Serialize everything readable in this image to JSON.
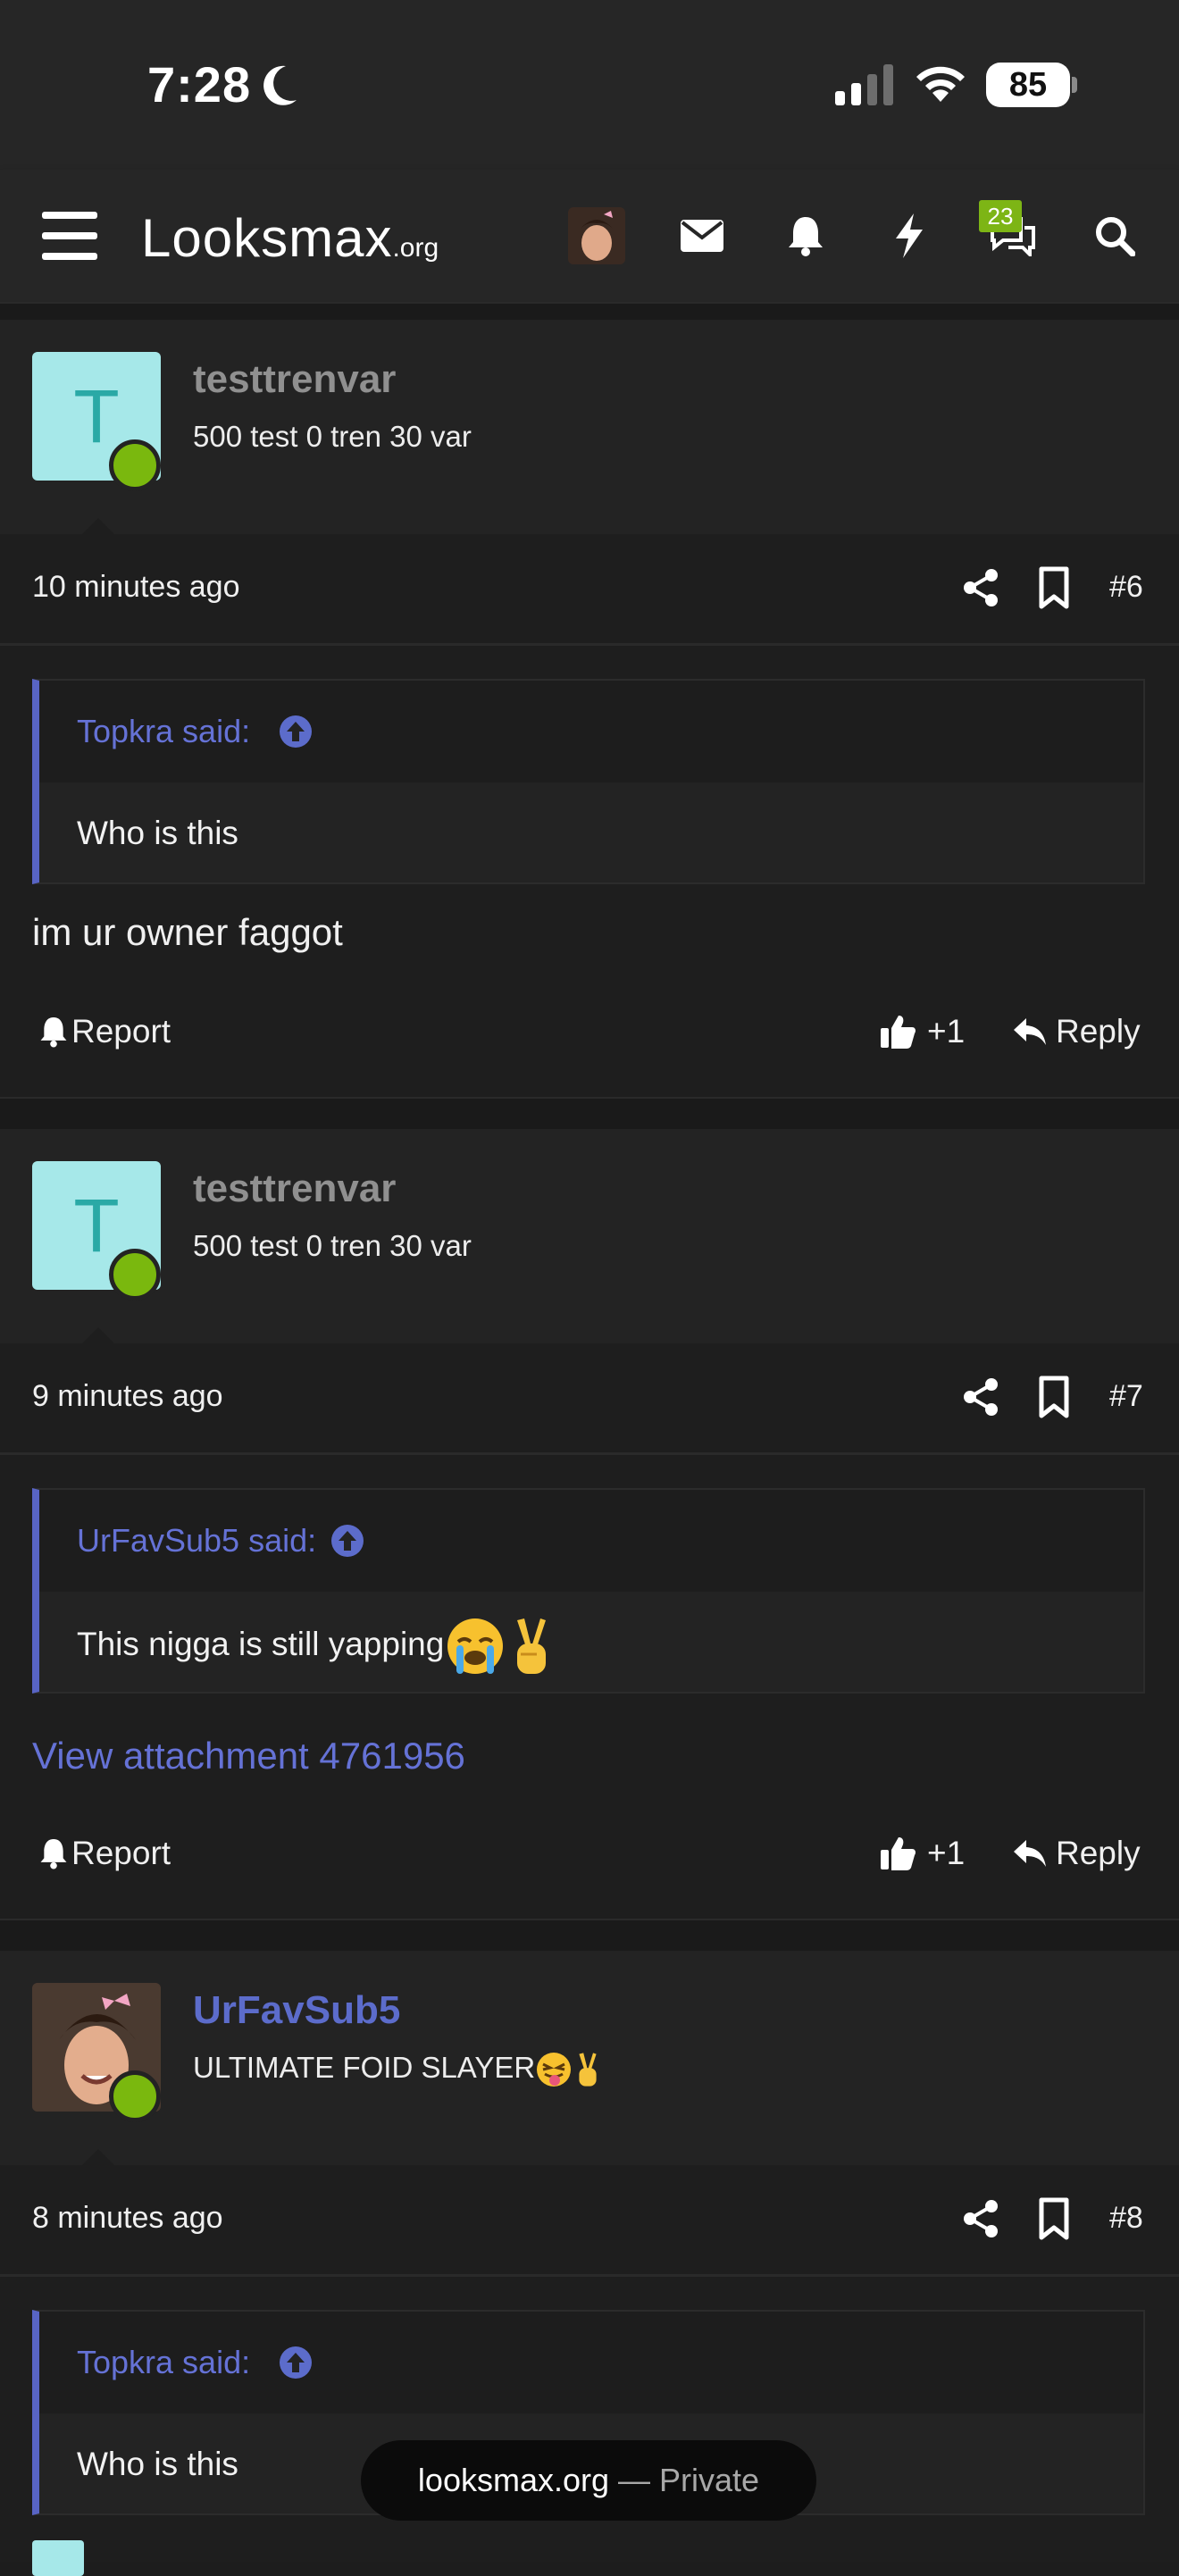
{
  "status_bar": {
    "time": "7:28",
    "battery": "85"
  },
  "nav": {
    "logo_main": "Looksmax",
    "logo_suffix": ".org",
    "chat_badge": "23"
  },
  "posts": [
    {
      "username": "testtrenvar",
      "avatar_letter": "T",
      "user_title": "500 test 0 tren 30 var",
      "timestamp": "10 minutes ago",
      "number": "#6",
      "quote_author": "Topkra said:",
      "quote_text": "Who is this",
      "message": "im ur owner faggot",
      "report_label": "Report",
      "like_label": "+1",
      "reply_label": "Reply"
    },
    {
      "username": "testtrenvar",
      "avatar_letter": "T",
      "user_title": "500 test 0 tren 30 var",
      "timestamp": "9 minutes ago",
      "number": "#7",
      "quote_author": "UrFavSub5 said:",
      "quote_text": "This nigga is still yapping",
      "attachment_link": "View attachment 4761956",
      "report_label": "Report",
      "like_label": "+1",
      "reply_label": "Reply"
    },
    {
      "username": "UrFavSub5",
      "user_title": "ULTIMATE FOID SLAYER",
      "timestamp": "8 minutes ago",
      "number": "#8",
      "quote_author": "Topkra said:",
      "quote_text": "Who is this"
    }
  ],
  "private_pill": {
    "domain": "looksmax.org",
    "separator": " — ",
    "mode": "Private"
  },
  "colors": {
    "accent": "#5c6ccb",
    "online": "#7ab80e",
    "badge": "#7db515"
  }
}
